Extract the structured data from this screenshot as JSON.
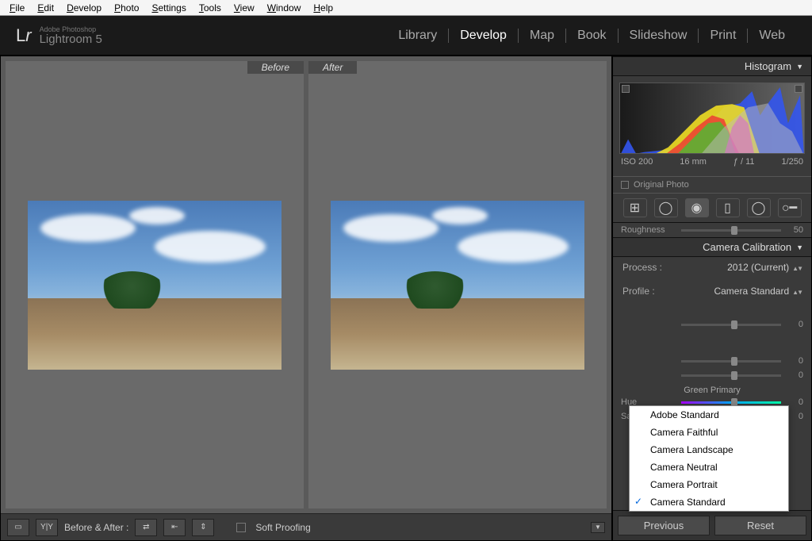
{
  "os_menu": [
    "File",
    "Edit",
    "Develop",
    "Photo",
    "Settings",
    "Tools",
    "View",
    "Window",
    "Help"
  ],
  "app": {
    "brand_small": "Adobe Photoshop",
    "brand_big": "Lightroom 5"
  },
  "modules": {
    "items": [
      "Library",
      "Develop",
      "Map",
      "Book",
      "Slideshow",
      "Print",
      "Web"
    ],
    "active": "Develop"
  },
  "compare": {
    "before": "Before",
    "after": "After"
  },
  "toolbar": {
    "ba_label": "Before & After :",
    "soft_proof": "Soft Proofing"
  },
  "right": {
    "histogram_title": "Histogram",
    "exif": {
      "iso": "ISO 200",
      "fl": "16 mm",
      "ap": "ƒ / 11",
      "sh": "1/250"
    },
    "orig": "Original Photo",
    "roughness": {
      "label": "Roughness",
      "value": "50"
    },
    "calibration_title": "Camera Calibration",
    "process": {
      "label": "Process :",
      "value": "2012 (Current)"
    },
    "profile": {
      "label": "Profile :",
      "value": "Camera Standard"
    },
    "profile_options": [
      "Adobe Standard",
      "Camera Faithful",
      "Camera Landscape",
      "Camera Neutral",
      "Camera Portrait",
      "Camera Standard"
    ],
    "profile_selected": "Camera Standard",
    "green": {
      "section": "Green Primary",
      "hue_label": "Hue",
      "hue_val": "0",
      "sat_label": "Saturation",
      "sat_val": "0"
    },
    "hidden_vals": {
      "a": "0",
      "b": "0",
      "c": "0"
    },
    "prev": "Previous",
    "reset": "Reset"
  }
}
